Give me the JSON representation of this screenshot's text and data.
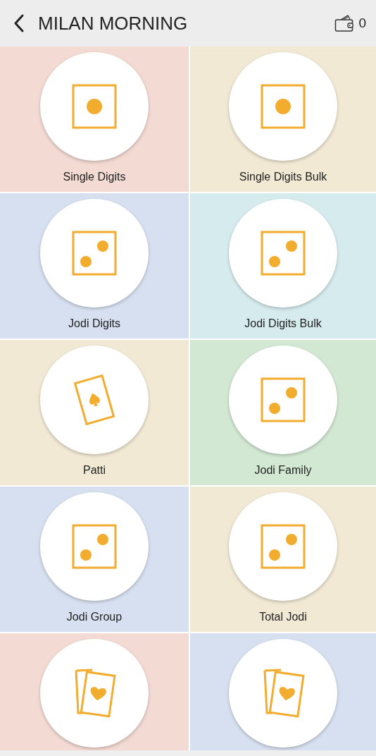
{
  "header": {
    "title": "MILAN MORNING",
    "wallet_balance": "0"
  },
  "games": [
    {
      "label": "Single Digits",
      "kind": "single",
      "color": "#f3dad2"
    },
    {
      "label": "Single Digits Bulk",
      "kind": "single",
      "color": "#f1e9d4"
    },
    {
      "label": "Jodi Digits",
      "kind": "pair",
      "color": "#d7e0f0"
    },
    {
      "label": "Jodi Digits Bulk",
      "kind": "pair",
      "color": "#d6ebee"
    },
    {
      "label": "Patti",
      "kind": "patti",
      "color": "#f1e9d4"
    },
    {
      "label": "Jodi Family",
      "kind": "pair",
      "color": "#d2e8d2"
    },
    {
      "label": "Jodi Group",
      "kind": "pair",
      "color": "#d7e0f0"
    },
    {
      "label": "Total Jodi",
      "kind": "pair",
      "color": "#f1e9d4"
    },
    {
      "kind": "multi",
      "color": "#f3dad2"
    },
    {
      "kind": "multi",
      "color": "#d7e0f0"
    }
  ]
}
